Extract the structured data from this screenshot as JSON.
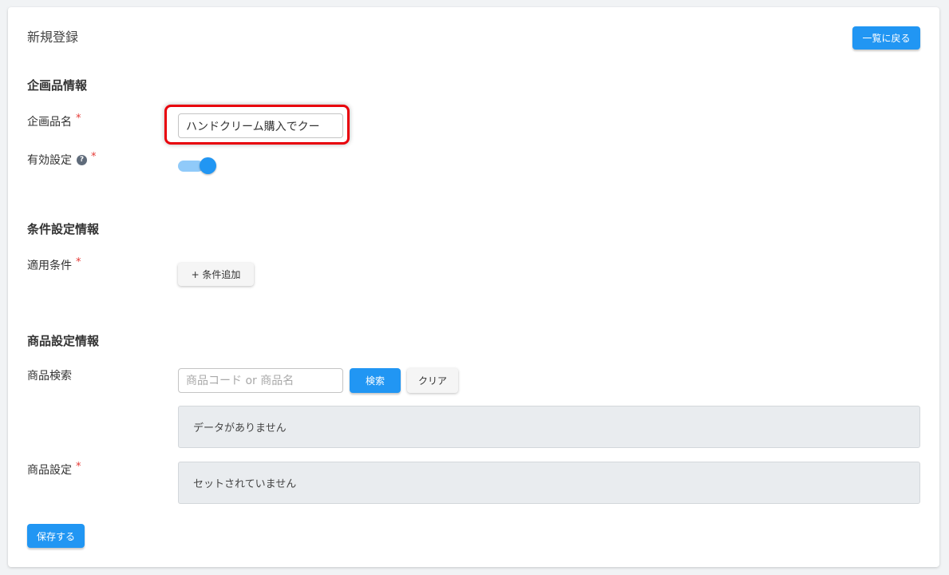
{
  "header": {
    "title": "新規登録",
    "back_button_label": "一覧に戻る"
  },
  "planning_section": {
    "heading": "企画品情報",
    "name_label": "企画品名",
    "name_value": "ハンドクリーム購入でクー",
    "enabled_label": "有効設定",
    "help_icon_glyph": "?",
    "enabled_state": true,
    "required_mark": "*"
  },
  "condition_section": {
    "heading": "条件設定情報",
    "apply_label": "適用条件",
    "add_condition_button": "+ 条件追加"
  },
  "product_section": {
    "heading": "商品設定情報",
    "search_label": "商品検索",
    "search_placeholder": "商品コード or 商品名",
    "search_button": "検索",
    "clear_button": "クリア",
    "search_result_empty": "データがありません",
    "setting_label": "商品設定",
    "setting_empty": "セットされていません"
  },
  "footer": {
    "save_button": "保存する"
  },
  "colors": {
    "primary": "#2196f3",
    "required": "#e53935",
    "highlight": "#e8000b",
    "toggle_track": "#90caf9"
  }
}
